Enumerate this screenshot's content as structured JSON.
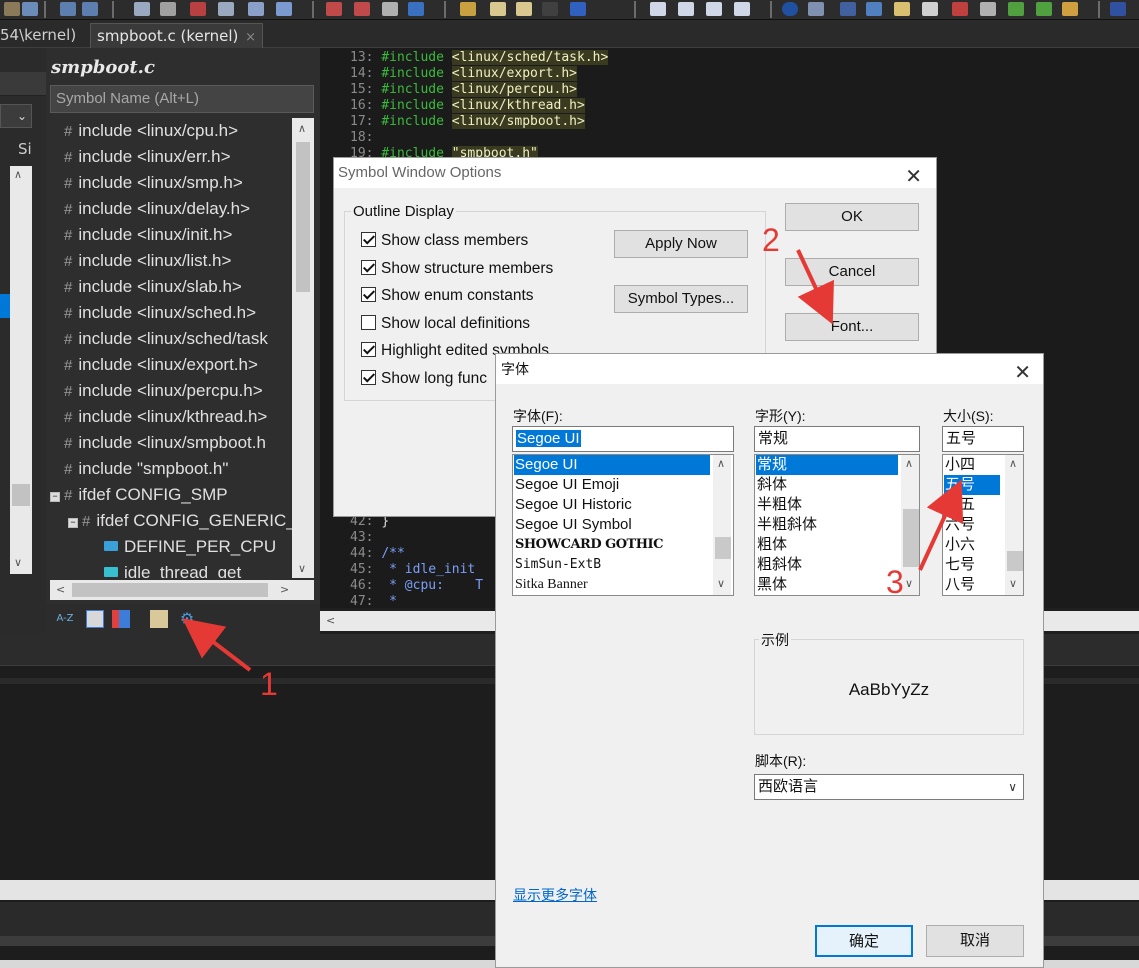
{
  "tabs": [
    {
      "label": "54\\kernel)"
    },
    {
      "label": "smpboot.c (kernel)",
      "close": "×"
    }
  ],
  "left_narrow": {
    "col_label": "Si"
  },
  "symbol_panel": {
    "title": "smpboot.c",
    "search_placeholder": "Symbol Name (Alt+L)",
    "items": [
      {
        "label": "include <linux/cpu.h>"
      },
      {
        "label": "include <linux/err.h>"
      },
      {
        "label": "include <linux/smp.h>"
      },
      {
        "label": "include <linux/delay.h>"
      },
      {
        "label": "include <linux/init.h>"
      },
      {
        "label": "include <linux/list.h>"
      },
      {
        "label": "include <linux/slab.h>"
      },
      {
        "label": "include <linux/sched.h>"
      },
      {
        "label": "include <linux/sched/task"
      },
      {
        "label": "include <linux/export.h>"
      },
      {
        "label": "include <linux/percpu.h>"
      },
      {
        "label": "include <linux/kthread.h>"
      },
      {
        "label": "include <linux/smpboot.h"
      },
      {
        "label": "include \"smpboot.h\""
      },
      {
        "label": "ifdef CONFIG_SMP"
      },
      {
        "label": "ifdef CONFIG_GENERIC_"
      },
      {
        "label": "DEFINE_PER_CPU"
      },
      {
        "label": "idle_thread_get"
      }
    ],
    "bottom_icons": [
      "az-sort-icon",
      "list-view-icon",
      "category-icon",
      "book-icon",
      "settings-gear-icon"
    ],
    "az_text": "A-Z"
  },
  "editor": {
    "lines": [
      {
        "num": "13:",
        "kw": "#include",
        "arg": "<linux/sched/task.h>"
      },
      {
        "num": "14:",
        "kw": "#include",
        "arg": "<linux/export.h>"
      },
      {
        "num": "15:",
        "kw": "#include",
        "arg": "<linux/percpu.h>"
      },
      {
        "num": "16:",
        "kw": "#include",
        "arg": "<linux/kthread.h>"
      },
      {
        "num": "17:",
        "kw": "#include",
        "arg": "<linux/smpboot.h>"
      },
      {
        "num": "18:",
        "kw": "",
        "arg": ""
      },
      {
        "num": "19:",
        "kw": "#include",
        "arg": "\"smpboot.h\""
      }
    ],
    "lower_lines": [
      {
        "num": "42:",
        "text": "}"
      },
      {
        "num": "43:",
        "text": ""
      },
      {
        "num": "44:",
        "text": "/**"
      },
      {
        "num": "45:",
        "text": " * idle_init"
      },
      {
        "num": "46:",
        "text": " * @cpu:    T"
      },
      {
        "num": "47:",
        "text": " *"
      }
    ]
  },
  "symbol_options_dialog": {
    "title": "Symbol Window Options",
    "close": "✕",
    "group_label": "Outline Display",
    "checkboxes": [
      {
        "label": "Show class members",
        "checked": true
      },
      {
        "label": "Show structure members",
        "checked": true
      },
      {
        "label": "Show enum constants",
        "checked": true
      },
      {
        "label": "Show local definitions",
        "checked": false
      },
      {
        "label": "Highlight edited symbols",
        "checked": true
      },
      {
        "label": "Show long func",
        "checked": true
      }
    ],
    "apply_now": "Apply Now",
    "symbol_types": "Symbol Types...",
    "ok": "OK",
    "cancel": "Cancel",
    "font": "Font..."
  },
  "font_dialog": {
    "title": "字体",
    "close": "✕",
    "font_label": "字体(F):",
    "font_value": "Segoe UI",
    "fonts": [
      "Segoe UI",
      "Segoe UI Emoji",
      "Segoe UI Historic",
      "Segoe UI Symbol",
      "SHOWCARD GOTHIC",
      "SimSun-ExtB",
      "Sitka Banner"
    ],
    "style_label": "字形(Y):",
    "style_value": "常规",
    "styles": [
      "常规",
      "斜体",
      "半粗体",
      "半粗斜体",
      "粗体",
      "粗斜体",
      "黑体"
    ],
    "size_label": "大小(S):",
    "size_value": "五号",
    "sizes": [
      "小四",
      "五号",
      "小五",
      "六号",
      "小六",
      "七号",
      "八号"
    ],
    "sample_label": "示例",
    "sample_text": "AaBbYyZz",
    "script_label": "脚本(R):",
    "script_value": "西欧语言",
    "more_fonts": "显示更多字体",
    "ok": "确定",
    "cancel": "取消"
  },
  "annotations": {
    "one": "1",
    "two": "2",
    "three": "3"
  },
  "colors": {
    "accent": "#0078d7",
    "annotation": "#e53935"
  }
}
